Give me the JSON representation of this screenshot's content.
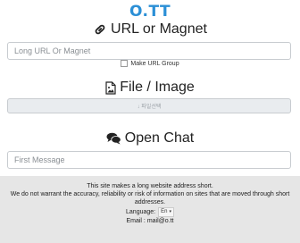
{
  "logo": "O.TT",
  "url_section": {
    "title": "URL or Magnet",
    "placeholder": "Long URL Or Magnet",
    "group_label": "Make URL Group"
  },
  "file_section": {
    "title": "File / Image",
    "button_label": "↓ 파일선택"
  },
  "chat_section": {
    "title": "Open Chat",
    "placeholder": "First Message"
  },
  "footer": {
    "line1": "This site makes a long website address short.",
    "line2": "We do not warrant the accuracy, reliability or risk of information on sites that are moved through short addresses.",
    "language_label": "Language:",
    "language_value": "En",
    "email": "Email : mail@o.tt"
  },
  "colors": {
    "brand": "#2b8fd6",
    "footer_bg": "#e6e6e6"
  }
}
